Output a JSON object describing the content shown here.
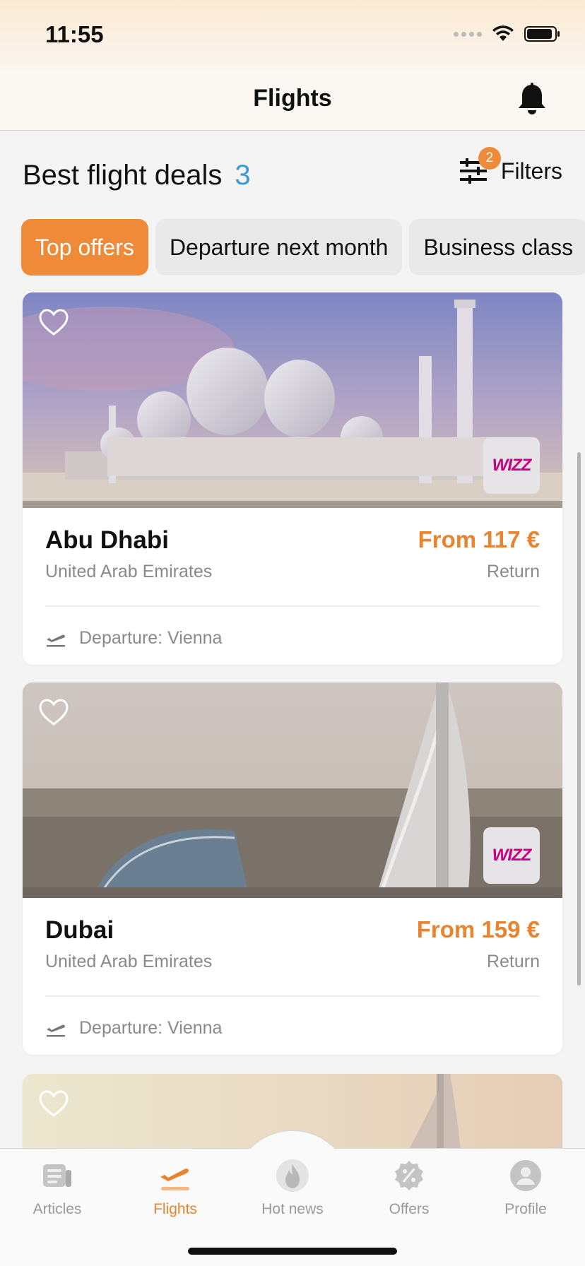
{
  "status_bar": {
    "time": "11:55"
  },
  "nav": {
    "title": "Flights"
  },
  "section": {
    "title": "Best flight deals",
    "count": "3"
  },
  "filters": {
    "label": "Filters",
    "badge": "2"
  },
  "chips": [
    {
      "label": "Top offers",
      "active": true
    },
    {
      "label": "Departure next month",
      "active": false
    },
    {
      "label": "Business class",
      "active": false
    }
  ],
  "deals": [
    {
      "city": "Abu Dhabi",
      "country": "United Arab Emirates",
      "price": "From 117 €",
      "trip_type": "Return",
      "departure": "Departure: Vienna",
      "airline_logo_text": "WIZZ"
    },
    {
      "city": "Dubai",
      "country": "United Arab Emirates",
      "price": "From 159 €",
      "trip_type": "Return",
      "departure": "Departure: Vienna",
      "airline_logo_text": "WIZZ"
    }
  ],
  "tabs": [
    {
      "label": "Articles",
      "icon": "articles-icon"
    },
    {
      "label": "Flights",
      "icon": "airplane-takeoff-icon"
    },
    {
      "label": "Hot news",
      "icon": "flame-icon"
    },
    {
      "label": "Offers",
      "icon": "percent-badge-icon"
    },
    {
      "label": "Profile",
      "icon": "profile-icon"
    }
  ],
  "colors": {
    "accent": "#ee8a38",
    "count_blue": "#3a9ad9",
    "muted_text": "#8a8a8a"
  }
}
